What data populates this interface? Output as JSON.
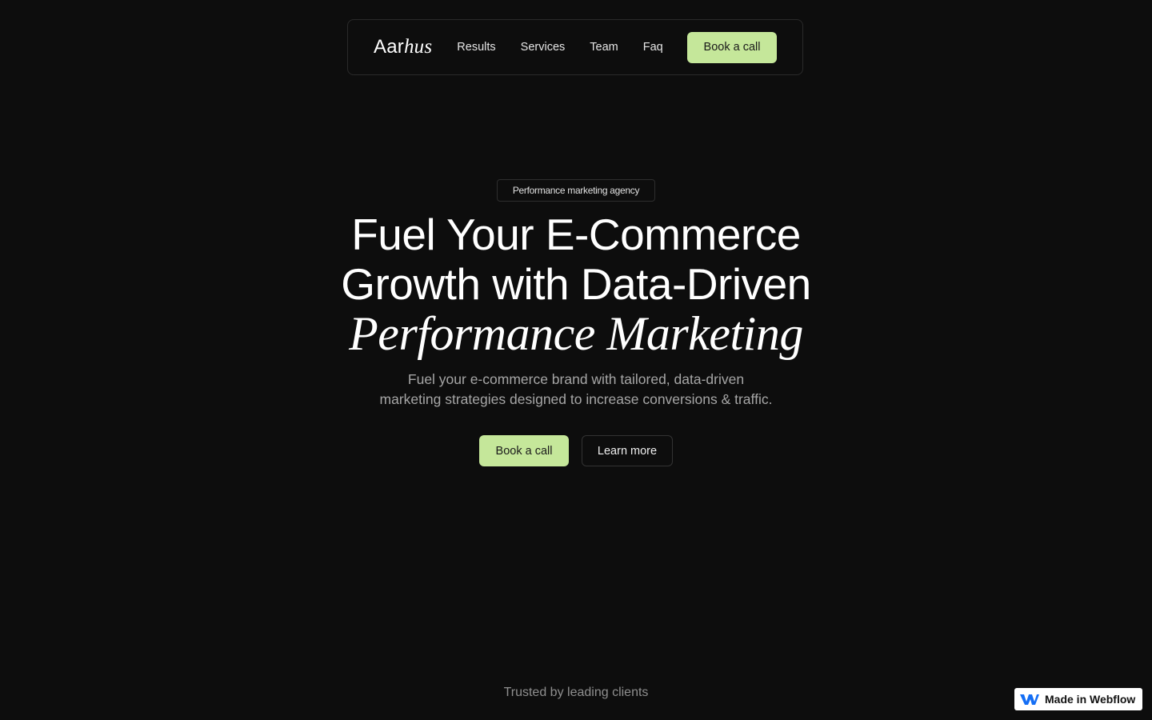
{
  "nav": {
    "logo_plain": "Aar",
    "logo_italic": "hus",
    "links": [
      "Results",
      "Services",
      "Team",
      "Faq"
    ],
    "cta": "Book a call"
  },
  "hero": {
    "badge": "Performance marketing agency",
    "headline_line1": "Fuel Your E-Commerce",
    "headline_line2": "Growth with Data-Driven",
    "headline_line3": "Performance Marketing",
    "subtext_line1": "Fuel your e-commerce brand with tailored, data-driven",
    "subtext_line2": "marketing strategies designed to increase conversions & traffic.",
    "primary_cta": "Book a call",
    "secondary_cta": "Learn more"
  },
  "trusted_label": "Trusted by leading clients",
  "webflow_badge": {
    "label": "Made in Webflow",
    "icon": "webflow-logo-icon"
  },
  "colors": {
    "background": "#0d0d0d",
    "accent": "#c5e79a",
    "webflow_blue": "#146ef5"
  }
}
